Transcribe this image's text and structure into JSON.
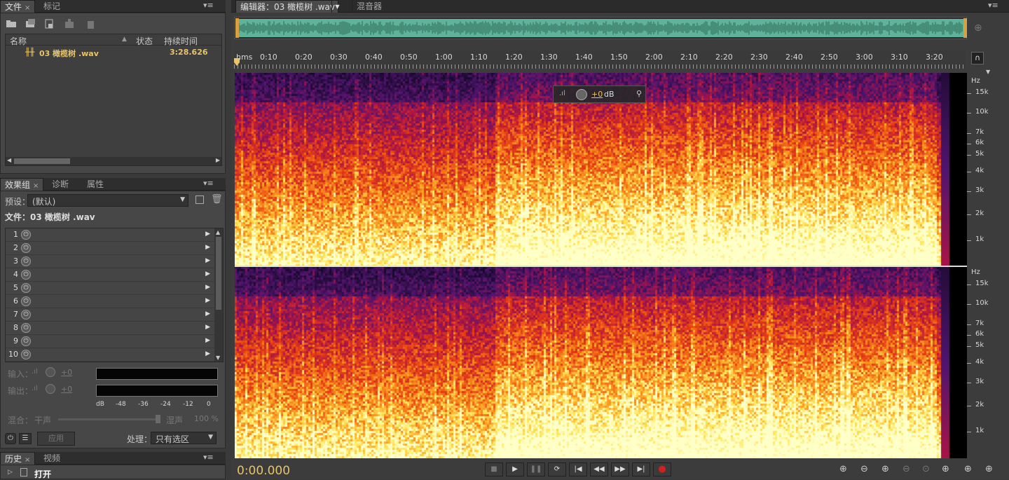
{
  "left_top_tabs": {
    "files": "文件",
    "markers": "标记"
  },
  "files_table": {
    "col_name": "名称",
    "col_status": "状态",
    "col_duration": "持续时间",
    "rows": [
      {
        "name": "03 橄榄树 .wav",
        "duration": "3:28.626"
      }
    ]
  },
  "effects_tabs": {
    "rack": "效果组",
    "diagnostics": "诊断",
    "properties": "属性"
  },
  "effects": {
    "preset_label": "预设：",
    "preset_value": "(默认)",
    "file_label": "文件：03 橄榄树 .wav",
    "slots": [
      "1",
      "2",
      "3",
      "4",
      "5",
      "6",
      "7",
      "8",
      "9",
      "10"
    ],
    "input_label": "输入：",
    "output_label": "输出：",
    "input_gain": "+0",
    "output_gain": "+0",
    "meter_scale": [
      "dB",
      "-48",
      "-36",
      "-24",
      "-12",
      "0"
    ],
    "mix_label": "混合：",
    "dry_label": "干声",
    "wet_label": "湿声",
    "mix_percent": "100 %",
    "apply_label": "应用",
    "process_label": "处理：",
    "process_value": "只有选区"
  },
  "history_tabs": {
    "history": "历史",
    "video": "视频"
  },
  "history_items": [
    "打开"
  ],
  "editor_tabs": {
    "editor": "编辑器：03 橄榄树 .wav",
    "mixer": "混音器"
  },
  "ruler": {
    "unit": "hms",
    "ticks": [
      "0:10",
      "0:20",
      "0:30",
      "0:40",
      "0:50",
      "1:00",
      "1:10",
      "1:20",
      "1:30",
      "1:40",
      "1:50",
      "2:00",
      "2:10",
      "2:20",
      "2:30",
      "2:40",
      "2:50",
      "3:00",
      "3:10",
      "3:20"
    ]
  },
  "hud": {
    "gain": "+0",
    "unit": "dB"
  },
  "hz_scale": {
    "unit": "Hz",
    "labels": [
      "15k",
      "10k",
      "7k",
      "6k",
      "5k",
      "4k",
      "3k",
      "2k",
      "1k"
    ]
  },
  "time_display": "0:00.000",
  "transport": [
    "stop",
    "play",
    "pause",
    "loop",
    "go-to-start",
    "rewind",
    "fast-forward",
    "go-to-end",
    "record"
  ],
  "colors": {
    "accent": "#e8c46a",
    "overview_wave": "#7fd0b0",
    "record": "#d02020"
  }
}
